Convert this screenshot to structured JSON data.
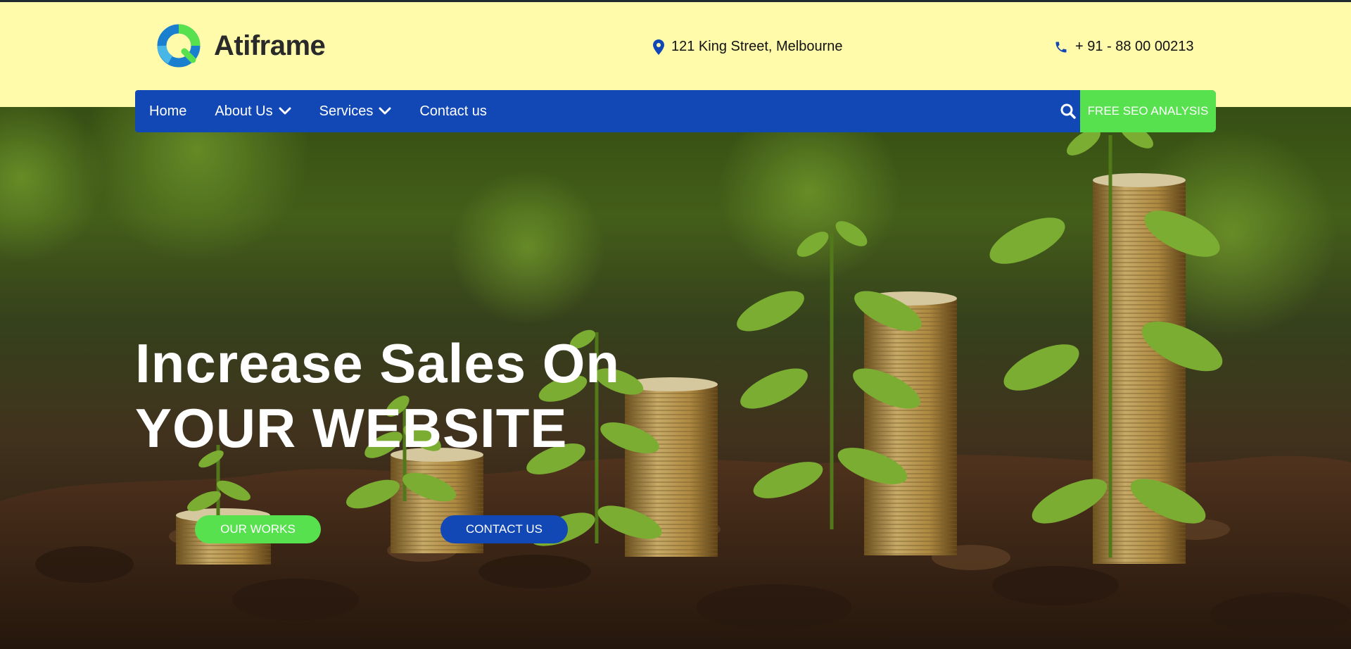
{
  "brand": {
    "name": "Atiframe"
  },
  "contact": {
    "address": "121 King Street, Melbourne",
    "phone": "+ 91 - 88 00 00213"
  },
  "nav": {
    "items": [
      {
        "label": "Home",
        "dropdown": false
      },
      {
        "label": "About Us",
        "dropdown": true
      },
      {
        "label": "Services",
        "dropdown": true
      },
      {
        "label": "Contact us",
        "dropdown": false
      }
    ],
    "cta": "FREE SEO ANALYSIS"
  },
  "hero": {
    "line1": "Increase Sales On",
    "line2": "YOUR WEBSITE",
    "button_primary": "OUR WORKS",
    "button_secondary": "CONTACT US"
  },
  "colors": {
    "header_bg": "#fffbab",
    "nav_bg": "#1248b6",
    "accent_green": "#58e14f",
    "text_dark": "#2a2a2a"
  },
  "icons": [
    "logo-mark-icon",
    "map-pin-icon",
    "phone-icon",
    "chevron-down-icon",
    "search-icon"
  ]
}
